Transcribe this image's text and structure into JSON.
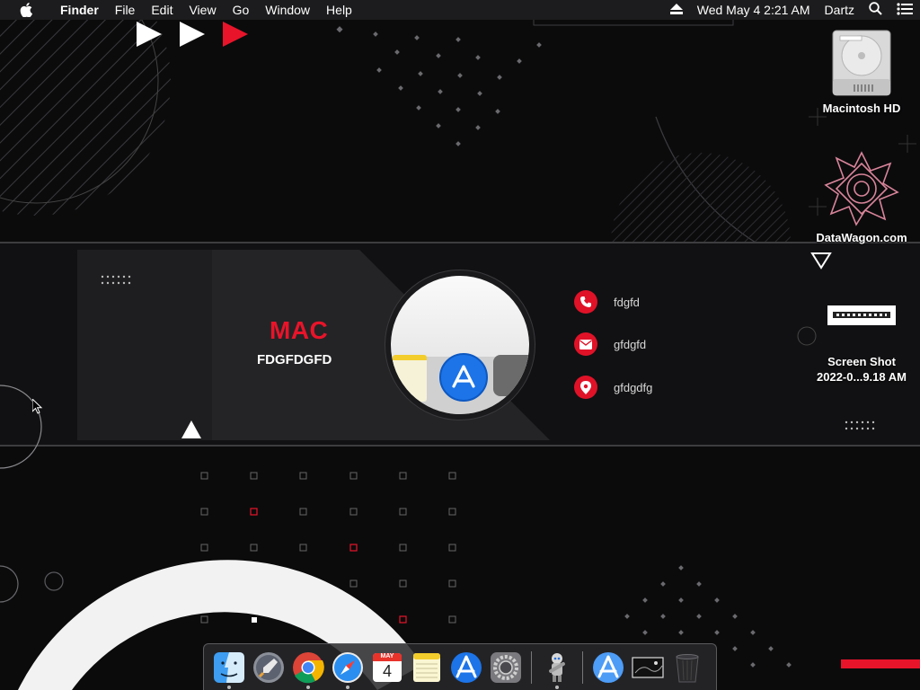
{
  "menubar": {
    "app_name": "Finder",
    "items": [
      "File",
      "Edit",
      "View",
      "Go",
      "Window",
      "Help"
    ],
    "datetime": "Wed May 4  2:21 AM",
    "user": "Dartz"
  },
  "desktop": {
    "icons": [
      {
        "label": "Macintosh HD",
        "icon": "hard-drive-icon"
      },
      {
        "label": "DataWagon.com",
        "icon": "datawagon-logo-icon"
      },
      {
        "label": "Screen Shot 2022-0...9.18 AM",
        "icon": "screenshot-file-icon"
      }
    ]
  },
  "card": {
    "title": "MAC",
    "subtitle": "FDGFDGFD",
    "contacts": [
      {
        "text": "fdgfd",
        "icon": "phone-icon"
      },
      {
        "text": "gfdgfd",
        "icon": "mail-icon"
      },
      {
        "text": "gfdgdfg",
        "icon": "location-pin-icon"
      }
    ]
  },
  "dock": {
    "items": [
      {
        "name": "Finder",
        "icon": "finder-icon",
        "running": true
      },
      {
        "name": "Launchpad",
        "icon": "launchpad-icon",
        "running": false
      },
      {
        "name": "Google Chrome",
        "icon": "chrome-icon",
        "running": true
      },
      {
        "name": "Safari",
        "icon": "safari-icon",
        "running": true
      },
      {
        "name": "Calendar",
        "icon": "calendar-icon",
        "running": false,
        "month": "MAY",
        "day": "4"
      },
      {
        "name": "Notes",
        "icon": "notes-icon",
        "running": false
      },
      {
        "name": "App Store",
        "icon": "app-store-icon",
        "running": false
      },
      {
        "name": "System Preferences",
        "icon": "system-preferences-icon",
        "running": false
      },
      {
        "name": "Automator",
        "icon": "automator-icon",
        "running": true
      },
      {
        "name": "Applications",
        "icon": "applications-folder-icon",
        "running": false
      },
      {
        "name": "Screenshot",
        "icon": "screenshot-stack-icon",
        "running": false
      },
      {
        "name": "Trash",
        "icon": "trash-icon",
        "running": false
      }
    ]
  },
  "colors": {
    "accent_red": "#e01228",
    "background": "#0b0b0c",
    "menubar": "#1c1c1e"
  }
}
